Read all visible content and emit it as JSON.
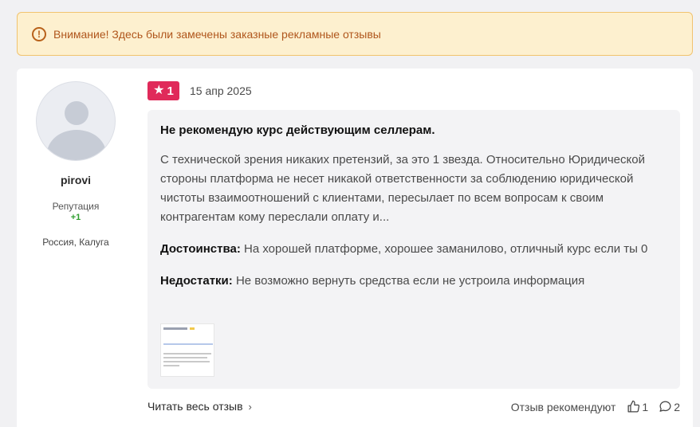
{
  "warning": {
    "icon": "exclamation-circle-icon",
    "text": "Внимание! Здесь были замечены заказные рекламные отзывы"
  },
  "author": {
    "name": "pirovi",
    "reputation_label": "Репутация",
    "reputation_value": "+1",
    "location": "Россия, Калуга"
  },
  "review": {
    "rating": "1",
    "date": "15 апр 2025",
    "title": "Не рекомендую курс действующим селлерам.",
    "text": "С технической зрения никаких претензий, за это 1 звезда. Относительно Юридической стороны платформа не несет никакой ответственности за соблюдению юридической чистоты взаимоотношений с клиентами, пересылает по всем вопросам к своим контрагентам кому переслали оплату и...",
    "pros_label": "Достоинства:",
    "pros_text": "На хорошей платформе, хорошее заманилово, отличный курс если ты 0",
    "cons_label": "Недостатки:",
    "cons_text": "Не возможно вернуть средства если не устроила информация"
  },
  "footer": {
    "read_more": "Читать весь отзыв",
    "recommend_text": "Отзыв рекомендуют",
    "likes": "1",
    "comments": "2"
  },
  "colors": {
    "rating_badge": "#e02a5a",
    "warning_bg": "#fdf0cf",
    "warning_text": "#b0561c",
    "reputation": "#2e9e2e"
  }
}
